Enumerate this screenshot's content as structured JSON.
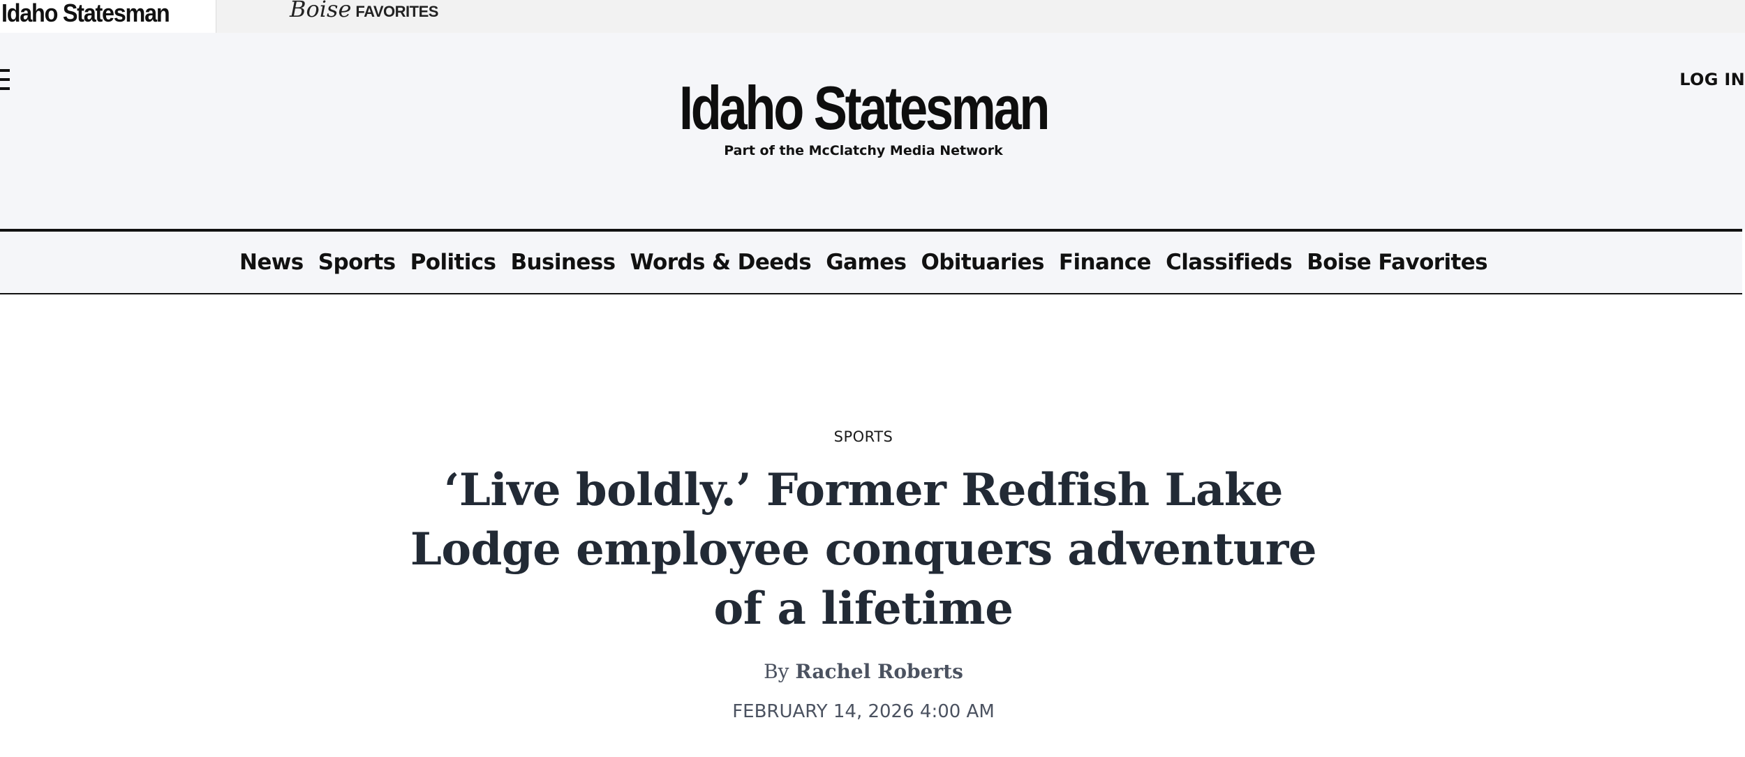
{
  "top_bar": {
    "active_tab_label": "Idaho Statesman",
    "favorites_script": "Boise",
    "favorites_caps": "FAVORITES"
  },
  "header": {
    "menu_icon": "hamburger-menu-icon",
    "login_label": "LOG IN",
    "logo_text": "Idaho Statesman",
    "tagline": "Part of the McClatchy Media Network"
  },
  "nav": {
    "items": [
      "News",
      "Sports",
      "Politics",
      "Business",
      "Words & Deeds",
      "Games",
      "Obituaries",
      "Finance",
      "Classifieds",
      "Boise Favorites"
    ]
  },
  "article": {
    "section": "SPORTS",
    "headline": "‘Live boldly.’ Former Redfish Lake Lodge employee conquers adventure of a lifetime",
    "byline_prefix": "By",
    "author": "Rachel Roberts",
    "date": "FEBRUARY 14, 2026 4:00 AM"
  },
  "colors": {
    "background": "#ffffff",
    "header_background": "#f5f6f9",
    "headline": "#222a35",
    "meta_text": "#4b5260"
  }
}
